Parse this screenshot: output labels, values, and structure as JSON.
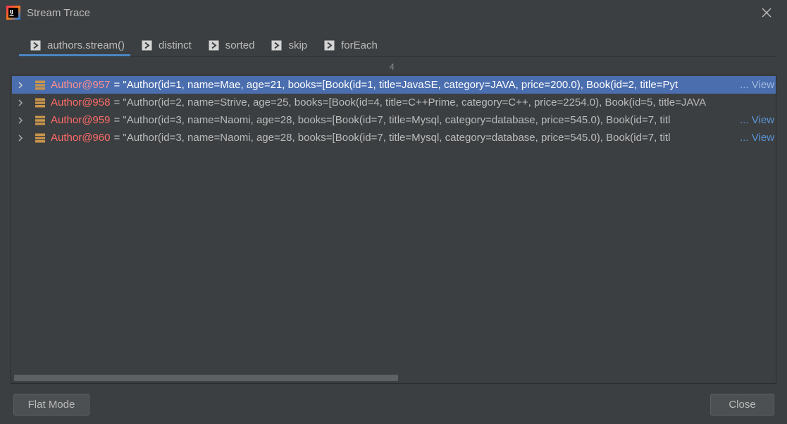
{
  "window": {
    "title": "Stream Trace",
    "icons": {
      "app": "intellij-icon",
      "close": "close-icon"
    }
  },
  "tabs": [
    {
      "label": "authors.stream()",
      "active": true,
      "icon": "stream-step-icon"
    },
    {
      "label": "distinct",
      "active": false,
      "icon": "stream-step-icon"
    },
    {
      "label": "sorted",
      "active": false,
      "icon": "stream-step-icon"
    },
    {
      "label": "skip",
      "active": false,
      "icon": "stream-step-icon"
    },
    {
      "label": "forEach",
      "active": false,
      "icon": "stream-step-icon"
    }
  ],
  "items_count": "4",
  "rows": [
    {
      "name": "Author@957",
      "value": "= \"Author(id=1, name=Mae, age=21, books=[Book(id=1, title=JavaSE, category=JAVA, price=200.0), Book(id=2, title=Pyt",
      "view_link": "... View",
      "selected": true
    },
    {
      "name": "Author@958",
      "value": "= \"Author(id=2, name=Strive, age=25, books=[Book(id=4, title=C++Prime, category=C++, price=2254.0), Book(id=5, title=JAVA",
      "view_link": "",
      "selected": false
    },
    {
      "name": "Author@959",
      "value": "= \"Author(id=3, name=Naomi, age=28, books=[Book(id=7, title=Mysql, category=database, price=545.0), Book(id=7, titl",
      "view_link": "... View",
      "selected": false
    },
    {
      "name": "Author@960",
      "value": "= \"Author(id=3, name=Naomi, age=28, books=[Book(id=7, title=Mysql, category=database, price=545.0), Book(id=7, titl",
      "view_link": "... View",
      "selected": false
    }
  ],
  "buttons": {
    "flat_mode": "Flat Mode",
    "close": "Close"
  },
  "colors": {
    "background": "#3c3f41",
    "selection": "#4b6eaf",
    "variable_name": "#ff6b68",
    "link": "#5894d4",
    "tab_underline": "#4a88c7"
  }
}
